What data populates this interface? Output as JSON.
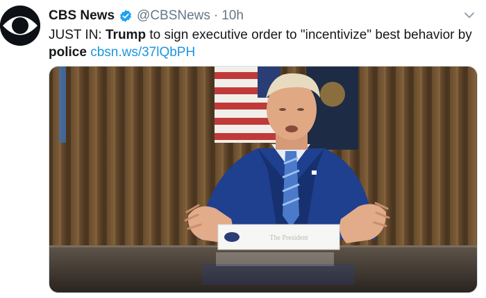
{
  "tweet": {
    "display_name": "CBS News",
    "handle": "@CBSNews",
    "separator": "·",
    "time": "10h",
    "text_prefix": "JUST IN: ",
    "text_bold_1": "Trump",
    "text_middle": " to sign executive order to \"incentivize\" best behavior by ",
    "text_bold_2": "police",
    "text_space": " ",
    "link": "cbsn.ws/37lQbPH"
  },
  "media": {
    "placard_text": "The President"
  },
  "colors": {
    "link": "#1b95e0",
    "verified": "#1da1f2",
    "secondary_text": "#657786"
  },
  "icons": {
    "avatar": "cbs-eye-logo",
    "verified": "verified-badge-icon",
    "menu": "chevron-down-icon"
  }
}
